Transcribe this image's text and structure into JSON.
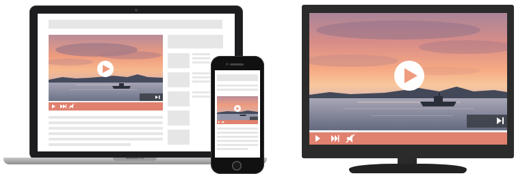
{
  "laptop": {
    "brand_text": "MacBook Pro"
  },
  "video": {
    "colors": {
      "sky_top": "#f0a08a",
      "sky_mid": "#f5b08a",
      "sun_glow": "#ffd9a8",
      "horizon": "#e6b4a0",
      "hills": "#4a4e60",
      "water": "#9aa0b0",
      "controls": "#e0816f"
    },
    "icons": [
      "play-icon",
      "skip-forward-icon",
      "mute-icon",
      "next-icon"
    ]
  }
}
